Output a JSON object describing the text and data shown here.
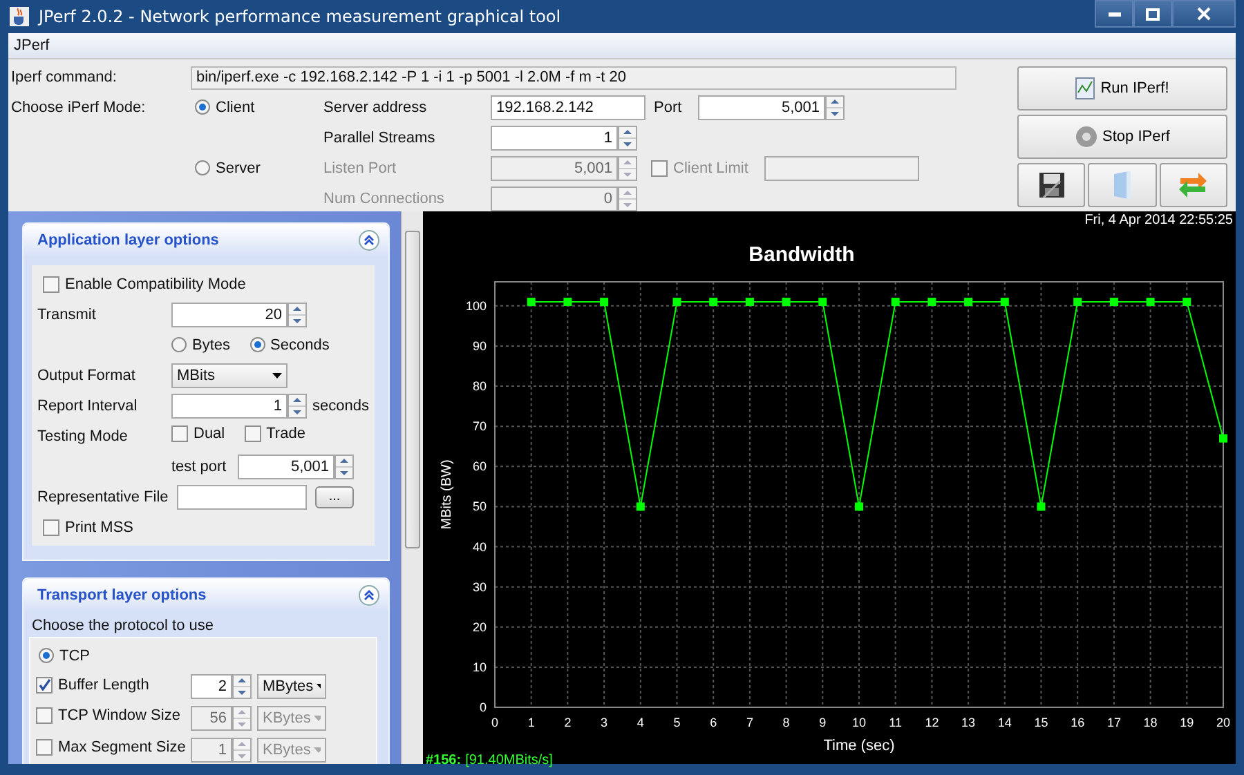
{
  "window": {
    "title": "JPerf 2.0.2 - Network performance measurement graphical tool"
  },
  "menu": [
    "JPerf"
  ],
  "command": {
    "label": "Iperf command:",
    "value": "bin/iperf.exe -c 192.168.2.142 -P 1 -i 1 -p 5001 -l 2.0M -f m -t 20"
  },
  "mode": {
    "label": "Choose iPerf Mode:",
    "options": [
      {
        "label": "Client",
        "selected": true
      },
      {
        "label": "Server",
        "selected": false
      }
    ]
  },
  "client": {
    "server_address": {
      "label": "Server address",
      "value": "192.168.2.142"
    },
    "port": {
      "label": "Port",
      "value": "5,001"
    },
    "parallel_streams": {
      "label": "Parallel Streams",
      "value": "1"
    }
  },
  "server": {
    "listen_port": {
      "label": "Listen Port",
      "value": "5,001",
      "disabled": true
    },
    "client_limit": {
      "label": "Client Limit",
      "checked": false,
      "disabled": true
    },
    "num_connections": {
      "label": "Num Connections",
      "value": "0",
      "disabled": true
    }
  },
  "actions": [
    {
      "kind": "run",
      "label": "Run IPerf!"
    },
    {
      "kind": "stop",
      "label": "Stop IPerf"
    }
  ],
  "tools": [
    {
      "kind": "save"
    },
    {
      "kind": "open"
    },
    {
      "kind": "refresh"
    }
  ],
  "application": {
    "title": "Application layer options",
    "compatibility": {
      "label": "Enable Compatibility Mode",
      "checked": false
    },
    "transmit": {
      "label": "Transmit",
      "value": "20",
      "units": [
        {
          "label": "Bytes",
          "selected": false
        },
        {
          "label": "Seconds",
          "selected": true
        }
      ]
    },
    "output_format": {
      "label": "Output Format",
      "value": "MBits"
    },
    "report_interval": {
      "label": "Report Interval",
      "value": "1",
      "unit": "seconds"
    },
    "testing_mode": {
      "label": "Testing Mode",
      "options": [
        {
          "label": "Dual",
          "checked": false
        },
        {
          "label": "Trade",
          "checked": false
        }
      ]
    },
    "test_port": {
      "label": "test port",
      "value": "5,001"
    },
    "representative_file": {
      "label": "Representative File",
      "button": "..."
    },
    "print_mss": {
      "label": "Print MSS",
      "checked": false
    }
  },
  "transport": {
    "title": "Transport layer options",
    "prompt": "Choose the protocol to use",
    "protocol": {
      "label": "TCP",
      "selected": true
    },
    "options": [
      {
        "label": "Buffer Length",
        "checked": true,
        "value": "2",
        "unit": "MBytes"
      },
      {
        "label": "TCP Window Size",
        "checked": false,
        "value": "56",
        "unit": "KBytes"
      },
      {
        "label": "Max Segment Size",
        "checked": false,
        "value": "1",
        "unit": "KBytes"
      }
    ]
  },
  "graph": {
    "timestamp": "Fri, 4 Apr 2014 22:55:25",
    "status_value": "[91.40MBits/s]",
    "chart_data": {
      "type": "line",
      "title": "Bandwidth",
      "xlabel": "Time (sec)",
      "ylabel": "MBits (BW)",
      "xlim": [
        0,
        20
      ],
      "ylim": [
        0,
        106
      ],
      "xticks": [
        0,
        1,
        2,
        3,
        4,
        5,
        6,
        7,
        8,
        9,
        10,
        11,
        12,
        13,
        14,
        15,
        16,
        17,
        18,
        19,
        20
      ],
      "yticks": [
        0,
        10,
        20,
        30,
        40,
        50,
        60,
        70,
        80,
        90,
        100
      ],
      "x": [
        1,
        2,
        3,
        4,
        5,
        6,
        7,
        8,
        9,
        10,
        11,
        12,
        13,
        14,
        15,
        16,
        17,
        18,
        19,
        20
      ],
      "grid": true,
      "series": [
        {
          "name": "#156:",
          "color": "#00ff00",
          "marker": "square",
          "values": [
            101,
            101,
            101,
            50,
            101,
            101,
            101,
            101,
            101,
            50,
            101,
            101,
            101,
            101,
            50,
            101,
            101,
            101,
            101,
            67
          ]
        }
      ]
    }
  }
}
